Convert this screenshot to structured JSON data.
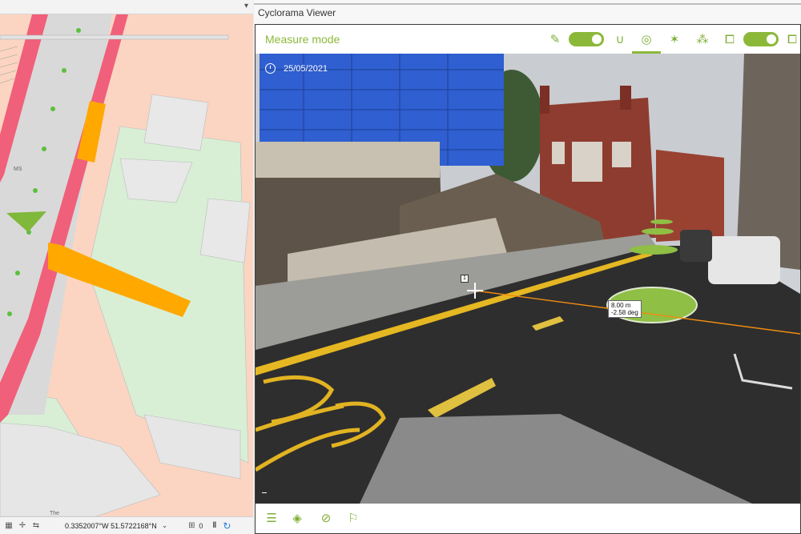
{
  "map": {
    "label_ms": "MS",
    "label_the": "The",
    "status": {
      "coordinates": "0.3352007°W 51.5722168°N",
      "scale_value": "0"
    }
  },
  "viewer": {
    "title": "Cyclorama Viewer",
    "mode_label": "Measure mode",
    "capture_date": "25/05/2021",
    "point_label": "1",
    "measurement": {
      "distance": "8.00 m",
      "angle": "-2.58 deg"
    }
  },
  "colors": {
    "accent": "#8cb83a",
    "road_red": "#f0607a",
    "footway_orange": "#ffa800",
    "parcel_green": "#d8efd6",
    "parcel_peach": "#fbd5c2"
  },
  "icons": {
    "toolbar": [
      "measure-point-icon",
      "magnet-icon",
      "target-icon",
      "star-icon",
      "network-icon",
      "frame-icon",
      "frame-right-icon"
    ],
    "bottombar": [
      "menu-icon",
      "layers-icon",
      "eye-off-icon",
      "feedback-icon"
    ]
  }
}
